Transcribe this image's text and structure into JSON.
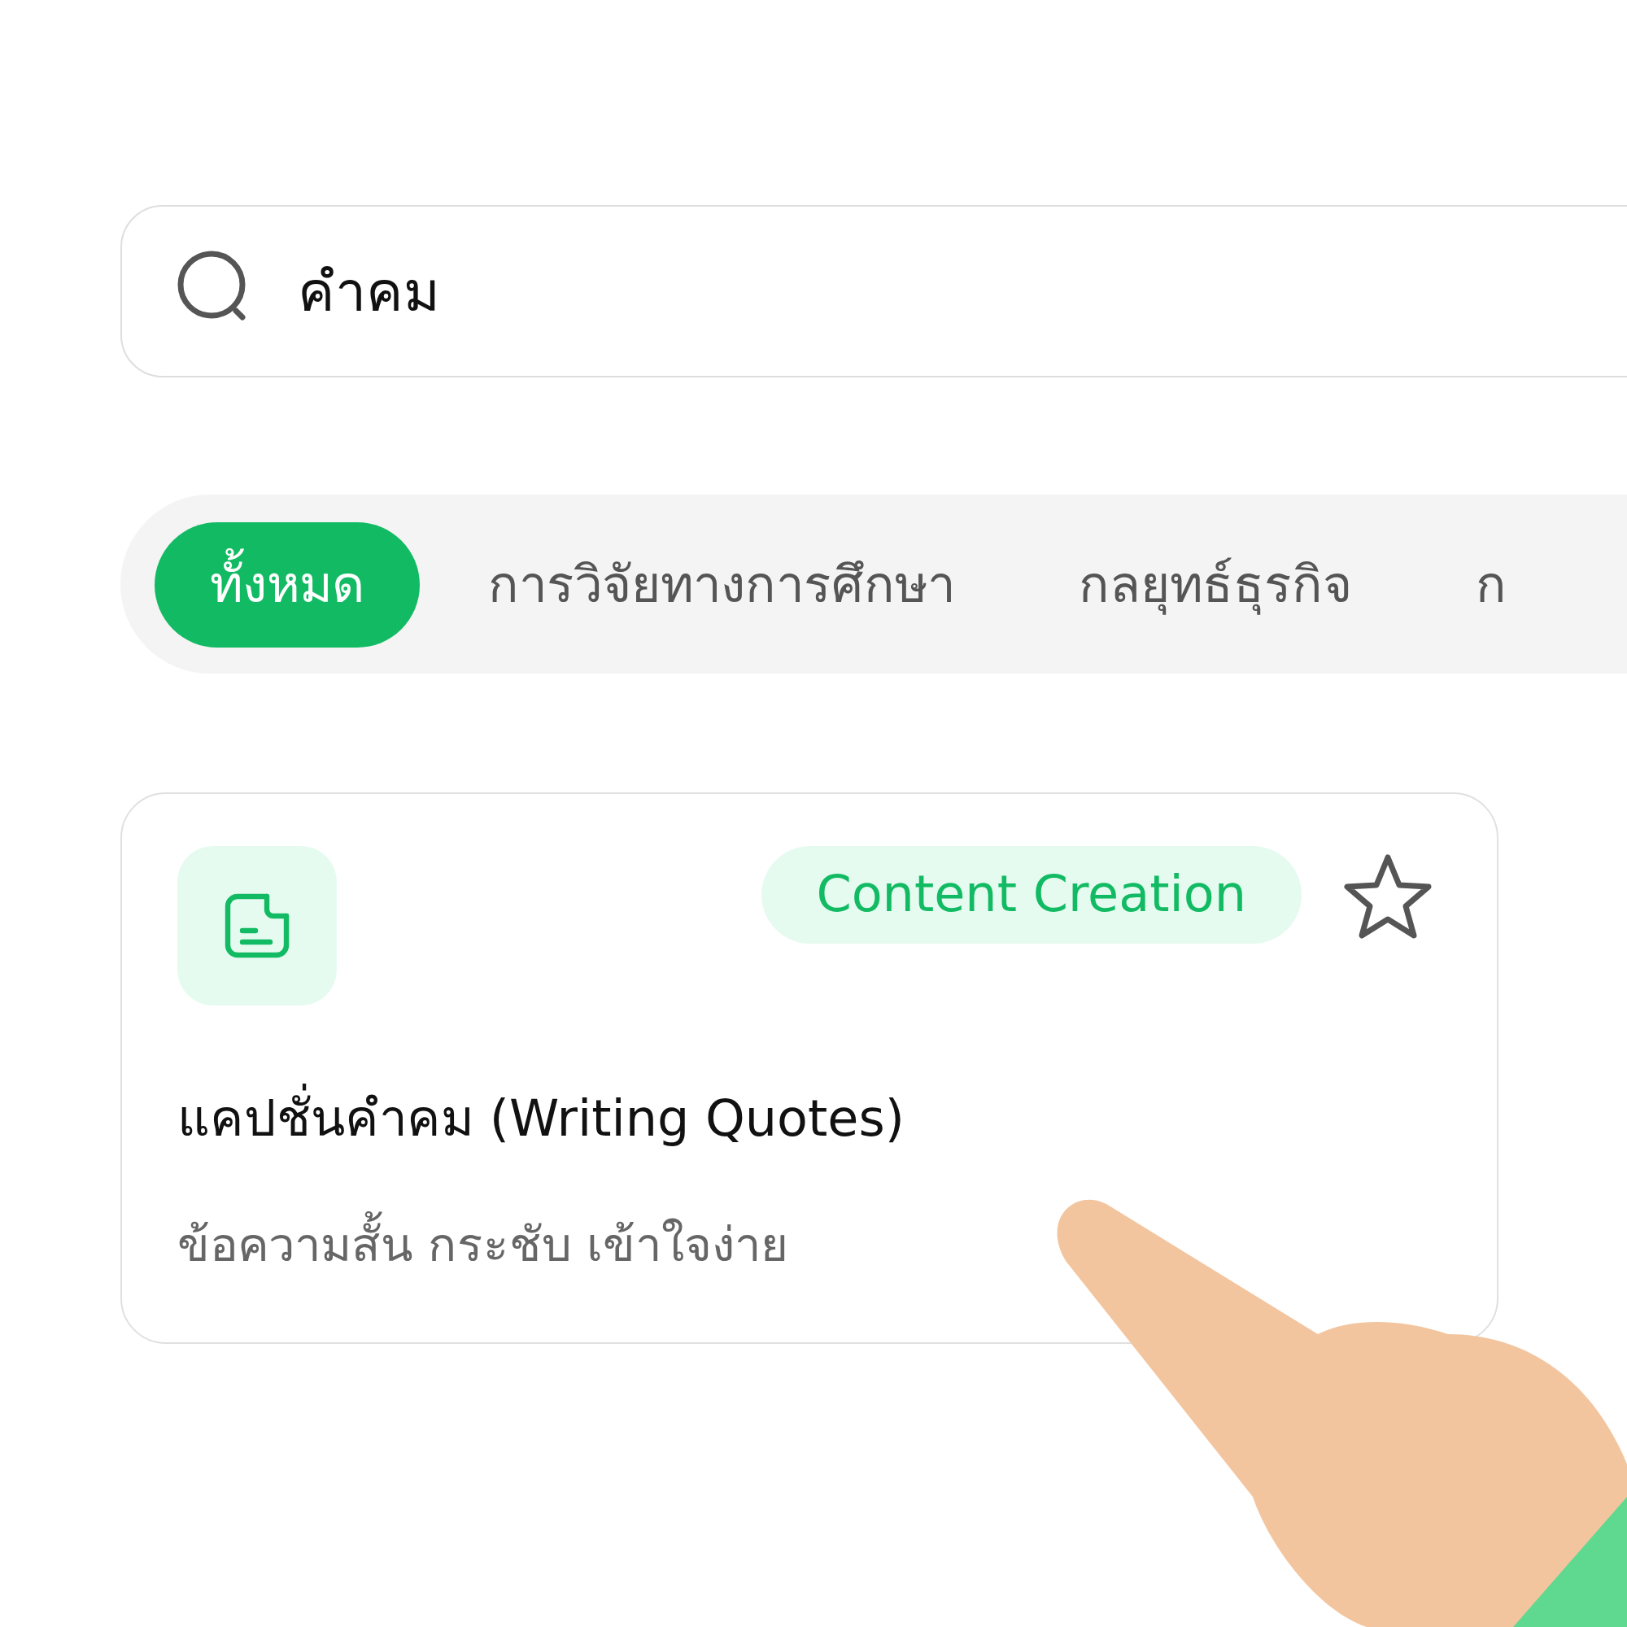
{
  "search": {
    "value": "คำคม"
  },
  "tabs": [
    {
      "label": "ทั้งหมด",
      "selected": true
    },
    {
      "label": "การวิจัยทางการศึกษา",
      "selected": false
    },
    {
      "label": "กลยุทธ์ธุรกิจ",
      "selected": false
    },
    {
      "label": "ก",
      "selected": false
    }
  ],
  "cards": [
    {
      "tag": "Content Creation",
      "favorite": false,
      "title": "แคปชั่นคำคม (Writing Quotes)",
      "description": "ข้อความสั้น กระชับ เข้าใจง่าย"
    }
  ]
}
